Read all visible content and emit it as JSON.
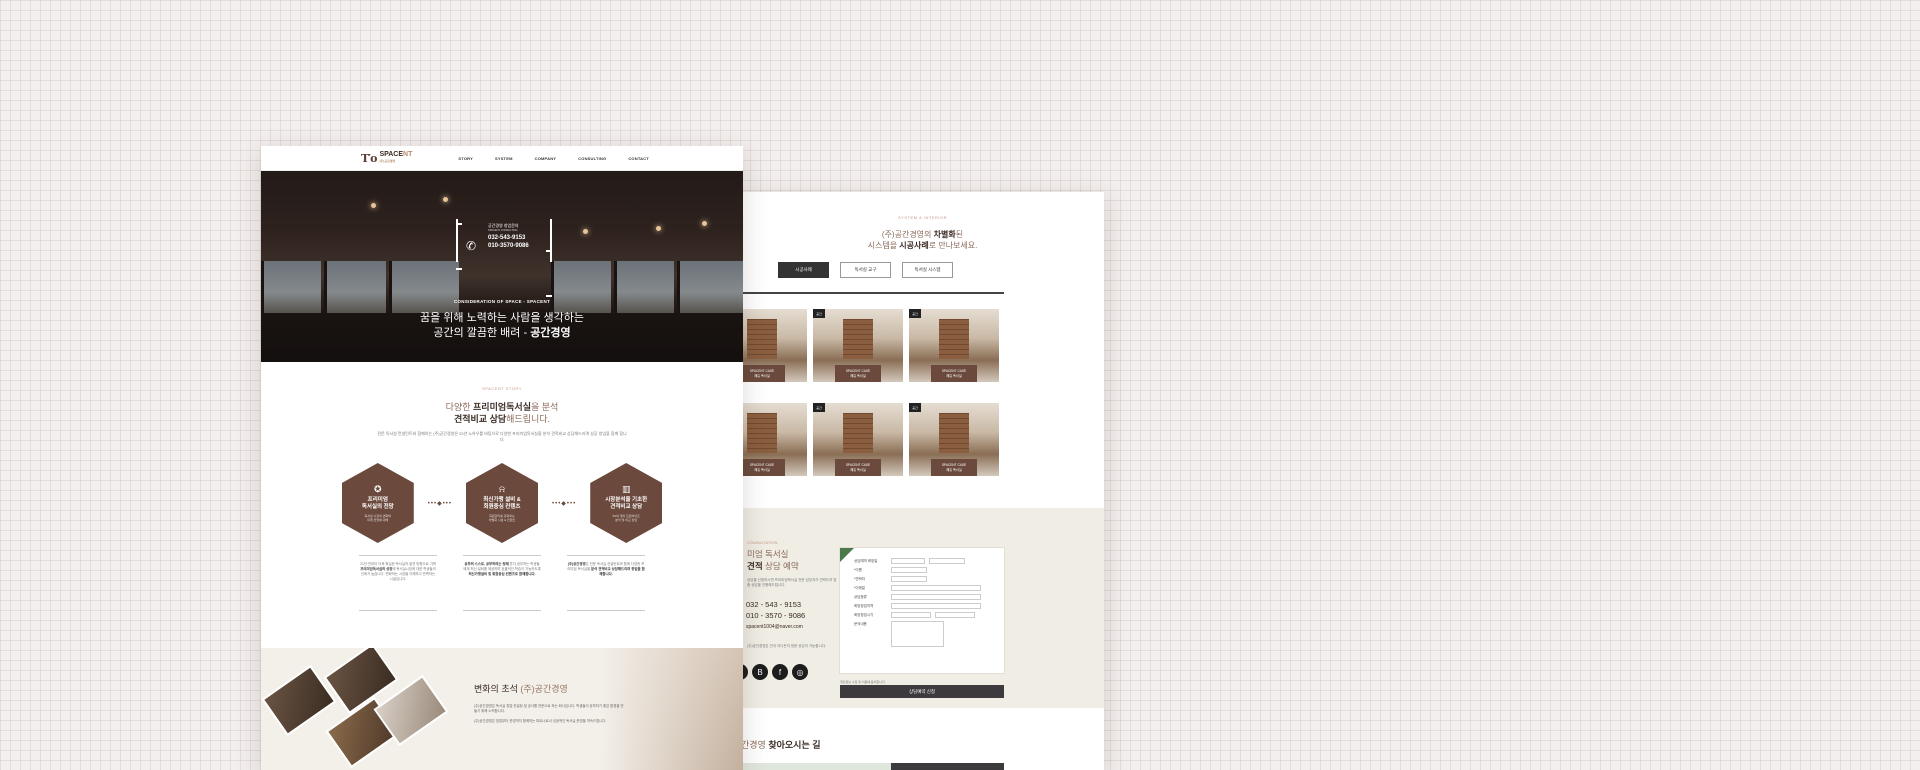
{
  "site": {
    "logo_mark": "T′o",
    "logo_name_a": "SPACE",
    "logo_name_b": "NT",
    "logo_sub": "(주)공간경영",
    "menu": [
      "STORY",
      "SYSTEM",
      "COMPANY",
      "CONSULTING",
      "CONTACT"
    ]
  },
  "hero": {
    "box_title": "공간경영 창업문의",
    "box_sub": "SPACENT CONSULTING",
    "phone1": "032-543-9153",
    "phone2": "010-3570-9086",
    "kicker": "CONSIDERATION OF SPACE - SPACENT",
    "line1": "꿈을 위해 노력하는 사람을 생각하는",
    "line2a": "공간의 깔끔한 배려 - ",
    "line2b": "공간경영"
  },
  "story": {
    "kicker": "SPACENT STORY",
    "title_a": "다양한 ",
    "title_b": "프리미엄독서실",
    "title_c": "을 분석",
    "title_d": "견적비교 상담",
    "title_e": "해드립니다.",
    "para": "전문 독서실 컨설턴트와 함께하는 (주)공간경영은 20년 노하우를 바탕으로 다양한 프리미엄독서실을 분석 견적비교 상담해드리며 성공 창업을 함께 합니다.",
    "cards": [
      {
        "title": "프리미엄\n독서실의 전망",
        "sub": "독서실 시장의 변화와\n미래 전망에 대해",
        "desc": "21년 전부터 더욱 확실한 독서실의 발전 방향으로 가며 ",
        "desc_b": "프리미엄독서실의 성장",
        "desc2": "에 독서실시장에 대한 학생들의 신뢰가 높습니다. 변화하는 시장을 이해하고 만족하는 시설입니다."
      },
      {
        "title": "최신가맹 설비 &\n회원중심 컨텐츠",
        "sub": "회원관리를 강화하는\n차별화 시설 & 컨텐츠",
        "desc_b": "공부의 스스로, 공부하려는 정체",
        "desc": " 혼자 공부하는 학생들에게 최신 설비를 제공하며 효율적인 학습이 가능하도록 ",
        "desc2": "최신가맹설비 및 회원중심 컨텐츠로 함께합니다."
      },
      {
        "title": "시장분석을 기초한\n견적비교 상담",
        "sub": "50여 개의 프랜차이즈\n분석 및 비교 상담",
        "desc_b": "(주)공간경영",
        "desc": "은 전문 독서실 컨설턴트와 함께 다양한 프리미엄 독서실을 ",
        "desc2": "분석 견적비교 상담해드리며 창업을 함께합니다."
      }
    ]
  },
  "change": {
    "title_a": "변화의 초석 ",
    "title_b": "(주)공간경영",
    "para1": "(주)공간경영은 독서실 창업 컨설팅 및 공사를 전문으로 하는 회사입니다. 학생들이 공부하기 좋은 환경을 만들기 위해 노력합니다.",
    "para2": "(주)공간경영은 창업부터 운영까지 함께하는 파트너로서 성공적인 독서실 운영을 약속드립니다."
  },
  "system": {
    "kicker": "SYSTEM & INTERIOR",
    "title_a": "(주)공간경영의 ",
    "title_b": "차별화",
    "title_c": "된",
    "title_d": "시스템을 ",
    "title_e": "시공사례",
    "title_f": "로 만나보세요.",
    "tabs": [
      "시공사례",
      "독서실 교구",
      "독서실 시스템"
    ],
    "tiles": [
      {
        "badge": "",
        "cap1": "SPACENT CASE",
        "cap2": "쾌유 독서실"
      },
      {
        "badge": "공간",
        "cap1": "SPACENT CASE",
        "cap2": "쾌유 독서실"
      },
      {
        "badge": "공간",
        "cap1": "SPACENT CASE",
        "cap2": "쾌유 독서실"
      },
      {
        "badge": "",
        "cap1": "SPACENT CASE",
        "cap2": "쾌유 독서실"
      },
      {
        "badge": "공간",
        "cap1": "SPACENT CASE",
        "cap2": "쾌유 독서실"
      },
      {
        "badge": "공간",
        "cap1": "SPACENT CASE",
        "cap2": "쾌유 독서실"
      }
    ]
  },
  "reserve": {
    "kicker": "CONSULTATION",
    "title_a": "미엄 독서실",
    "title_b": "견적",
    "title_c": " 상담 예약",
    "para": "상담을 신청하시면 프리미엄독서실 전문 담당자가 연락드려 맞춤 상담을 진행해드립니다.",
    "phone1": "032 - 543 - 9153",
    "phone2": "010 - 3570 - 9086",
    "email": "spacent1004@naver.com",
    "note": "(주)공간경영은 전국 어디든지 방문 상담이 가능합니다.",
    "fields": [
      "상담예약 희망일",
      "*이름",
      "*연락처",
      "*이메일",
      "상담종류",
      "희망창업지역",
      "희망창업시기",
      "문의내용"
    ],
    "agree_note": "개인정보 수집 및 이용에 동의합니다.",
    "submit": "상담예약 신청"
  },
  "directions": {
    "title_a": "간경영 ",
    "title_b": "찾아오시는 길"
  }
}
